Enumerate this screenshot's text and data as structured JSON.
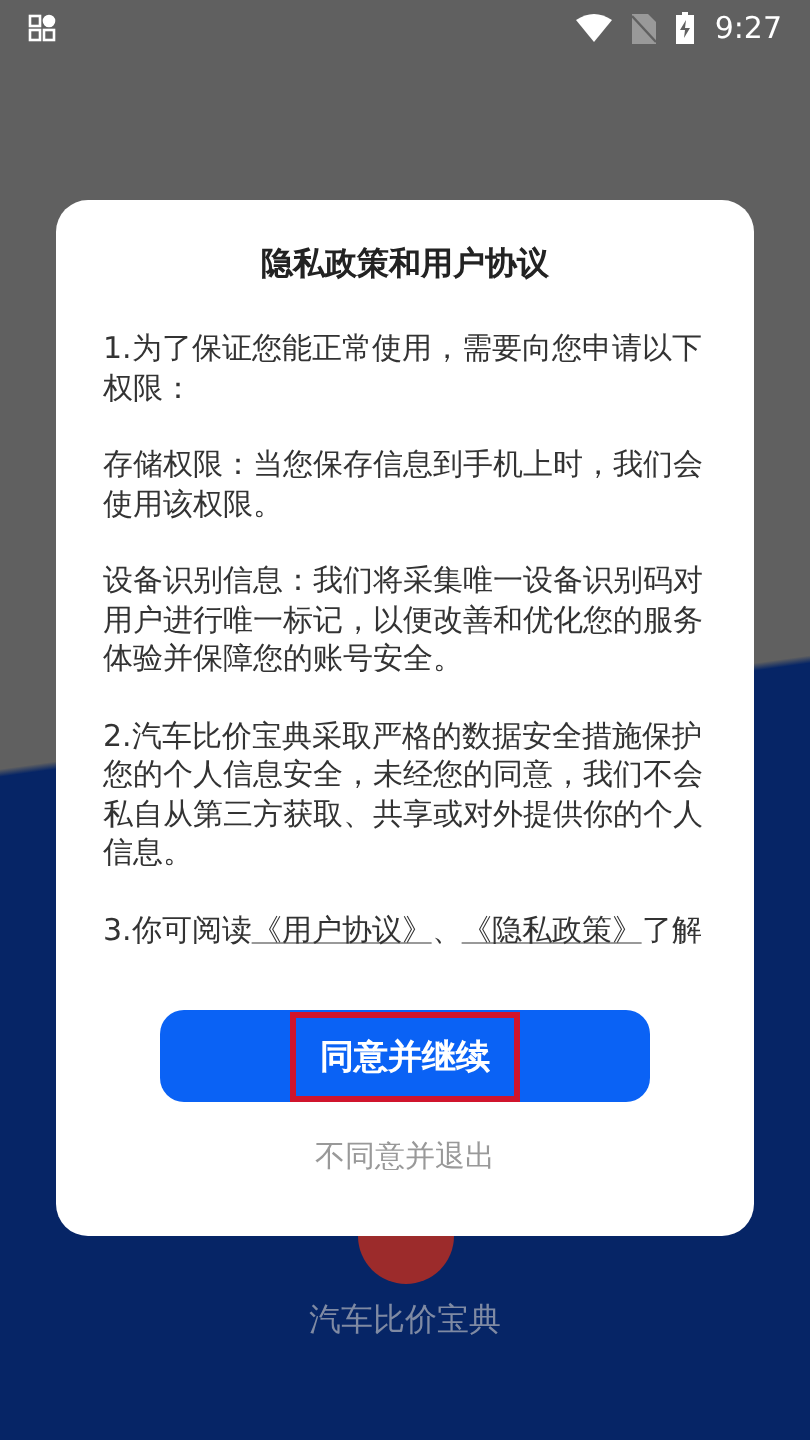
{
  "status_bar": {
    "time": "9:27"
  },
  "dialog": {
    "title": "隐私政策和用户协议",
    "paragraphs": [
      {
        "kind": "text",
        "text": "1.为了保证您能正常使用，需要向您申请以下权限："
      },
      {
        "kind": "text",
        "text": "存储权限：当您保存信息到手机上时，我们会使用该权限。"
      },
      {
        "kind": "text",
        "text": "设备识别信息：我们将采集唯一设备识别码对用户进行唯一标记，以便改善和优化您的服务体验并保障您的账号安全。"
      },
      {
        "kind": "text",
        "text": "2.汽车比价宝典采取严格的数据安全措施保护您的个人信息安全，未经您的同意，我们不会私自从第三方获取、共享或对外提供你的个人信息。"
      },
      {
        "kind": "links",
        "before": "3.你可阅读",
        "link_1": "《用户协议》",
        "separator": "、",
        "link_2": "《隐私政策》",
        "after": "了解"
      }
    ],
    "agree_button": {
      "label": "同意并继续",
      "highlighted": true
    },
    "decline_link": "不同意并退出"
  },
  "app_name": "汽车比价宝典"
}
